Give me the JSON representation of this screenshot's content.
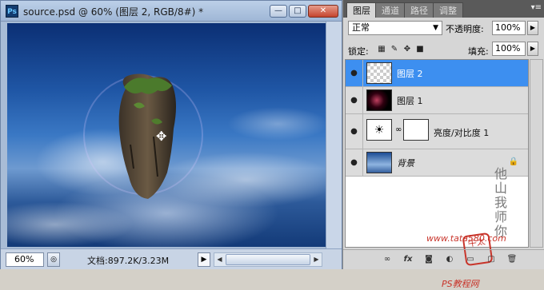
{
  "document": {
    "app_icon_label": "Ps",
    "title": "source.psd @ 60% (图层 2, RGB/8#) *",
    "window_buttons": {
      "minimize": "—",
      "maximize": "□",
      "close": "✕"
    },
    "zoom": "60%",
    "doc_info": "文档:897.2K/3.23M"
  },
  "panel": {
    "tabs": [
      "图层",
      "通道",
      "路径",
      "调整"
    ],
    "menu_icon": "▾≡",
    "blend_mode": "正常",
    "opacity_label": "不透明度:",
    "opacity_value": "100%",
    "lock_label": "锁定:",
    "fill_label": "填充:",
    "fill_value": "100%",
    "layers": [
      {
        "name": "图层 2",
        "selected": true
      },
      {
        "name": "图层 1",
        "selected": false
      },
      {
        "name": "亮度/对比度 1",
        "selected": false
      },
      {
        "name": "背景",
        "selected": false,
        "locked": true
      }
    ]
  },
  "watermark": {
    "text": "他山我师你",
    "seal": "牛太",
    "site_name": "PS教程网",
    "site_url": "www.tata580.com"
  },
  "colors": {
    "selection": "#3d8ff0",
    "panel_bg": "#d6d6d6",
    "doc_frame": "#a8bcd6"
  }
}
